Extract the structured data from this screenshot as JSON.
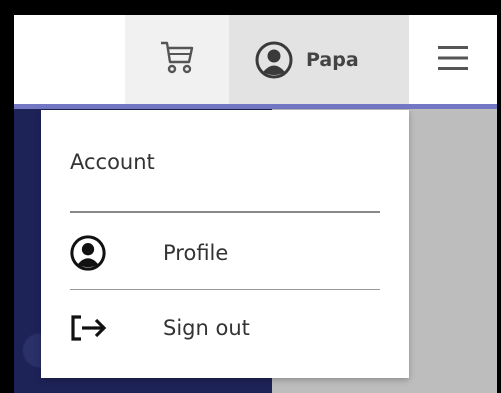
{
  "header": {
    "cart_icon": "shopping-cart-icon",
    "user_icon": "user-circle-icon",
    "username": "Papa",
    "menu_icon": "hamburger-menu-icon"
  },
  "dropdown": {
    "heading": "Account",
    "items": [
      {
        "label": "Profile",
        "icon": "user-circle-icon"
      },
      {
        "label": "Sign out",
        "icon": "sign-out-icon"
      }
    ]
  },
  "colors": {
    "accent": "#7478c4",
    "panel": "#1e2357",
    "page_background": "#bdbdbd"
  }
}
